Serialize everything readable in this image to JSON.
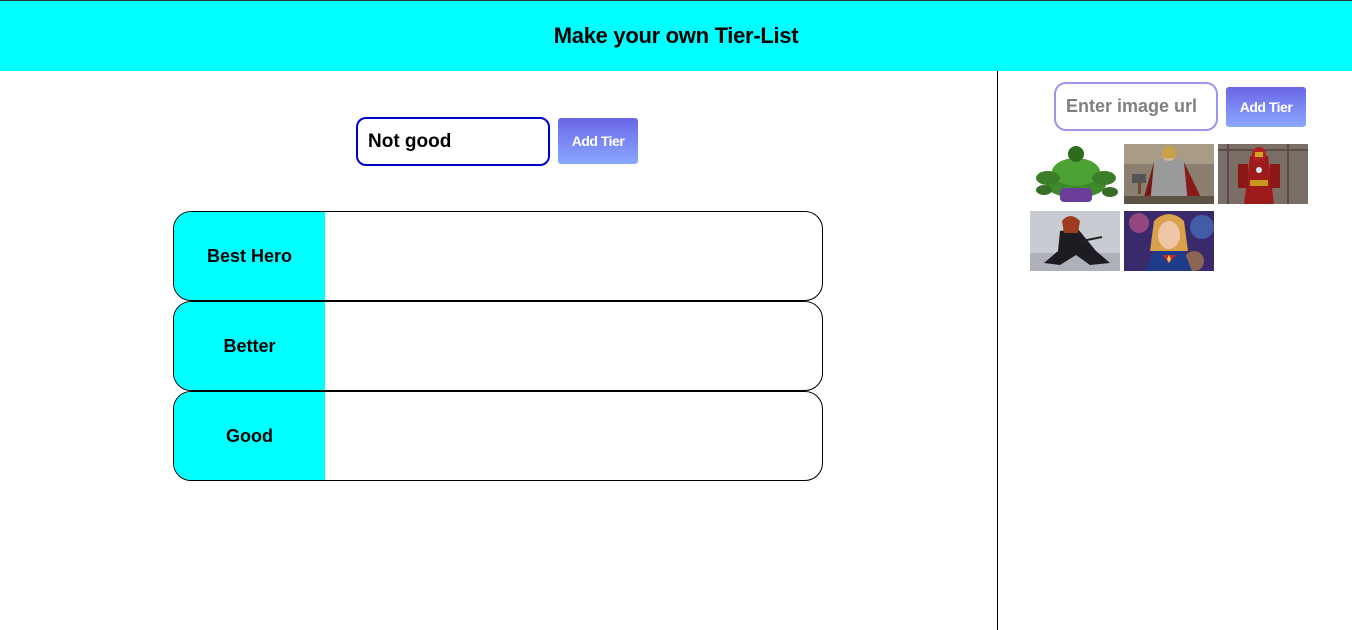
{
  "header": {
    "title": "Make your own Tier-List"
  },
  "tier_form": {
    "input_value": "Not good",
    "button_label": "Add Tier"
  },
  "tiers": [
    {
      "label": "Best Hero"
    },
    {
      "label": "Better"
    },
    {
      "label": "Good"
    }
  ],
  "image_form": {
    "placeholder": "Enter image url",
    "button_label": "Add Tier"
  },
  "images": [
    {
      "name": "hulk-image"
    },
    {
      "name": "thor-image"
    },
    {
      "name": "iron-man-image"
    },
    {
      "name": "black-widow-image"
    },
    {
      "name": "captain-marvel-image"
    }
  ],
  "colors": {
    "accent": "#00ffff",
    "button_gradient_top": "#6b66e6",
    "button_gradient_bottom": "#8aa9ff",
    "input_border": "#0000cc"
  }
}
